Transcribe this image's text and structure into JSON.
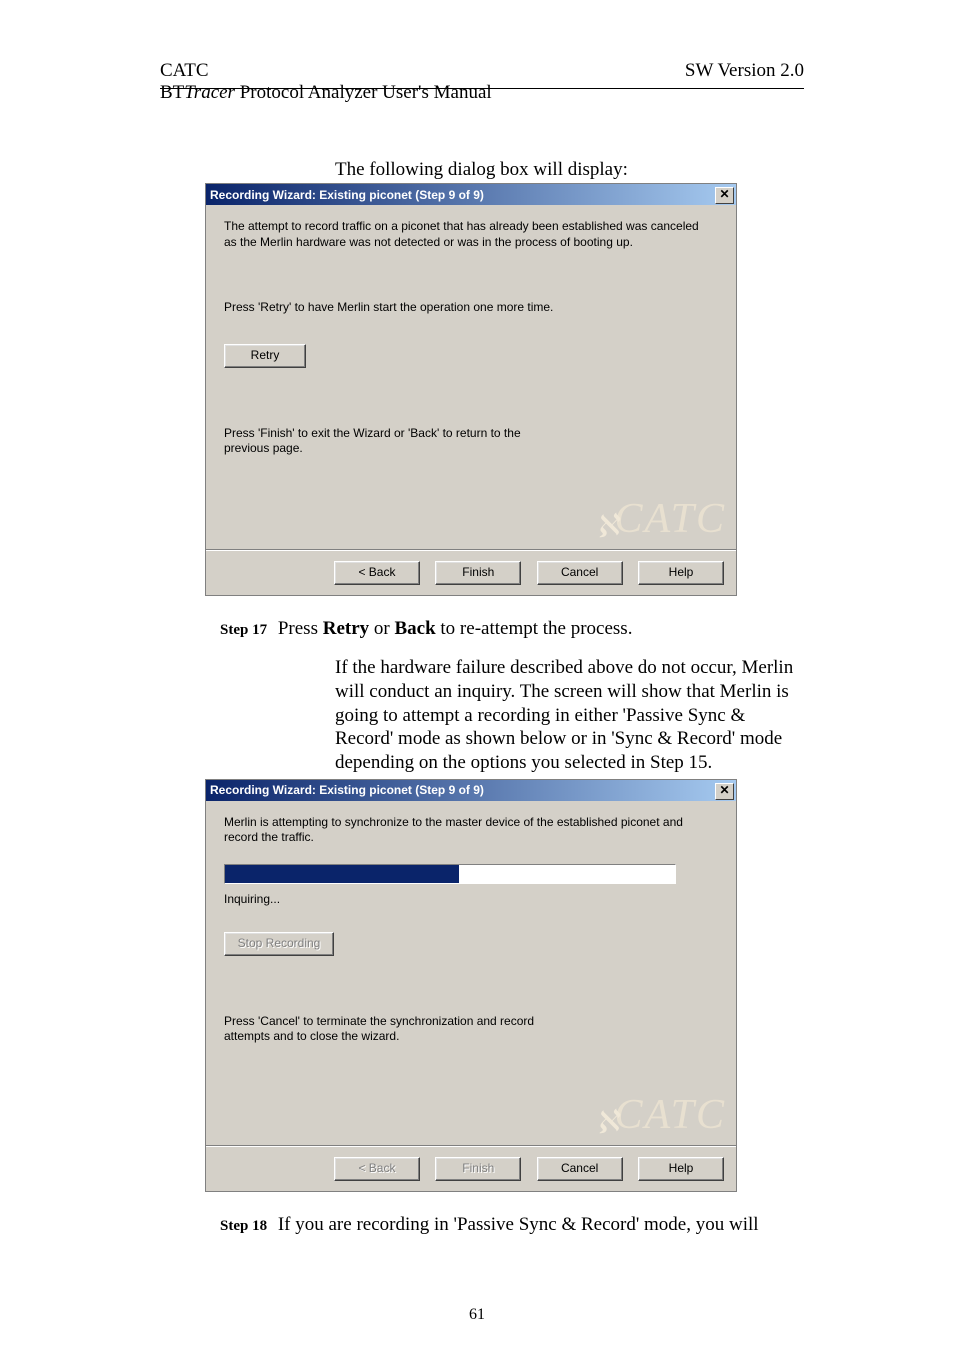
{
  "header": {
    "left": "CATC",
    "center_prefix": "BT",
    "center_italic": "Tracer",
    "center_suffix": " Protocol Analyzer User's Manual",
    "right": "SW Version 2.0"
  },
  "caption1": "The following dialog box will display:",
  "dialog1": {
    "title": "Recording Wizard: Existing piconet (Step 9 of 9)",
    "msg1": "The attempt to record traffic on a piconet that has already been established was canceled as the Merlin hardware was not detected or was in the process of booting up.",
    "msg2": "Press 'Retry' to have Merlin start the operation one more time.",
    "retry": "Retry",
    "msg3": "Press 'Finish' to exit the Wizard or 'Back' to return to the previous page.",
    "watermark": "CATC",
    "back": "< Back",
    "finish": "Finish",
    "cancel": "Cancel",
    "help": "Help"
  },
  "step17": {
    "label": "Step 17",
    "text_prefix": "Press ",
    "retry": "Retry",
    "text_mid": " or ",
    "back": "Back",
    "text_suffix": " to re-attempt the process."
  },
  "para1": "If the hardware failure described above do not occur, Merlin will conduct an inquiry.  The screen will show that Merlin is going to attempt a recording in either 'Passive Sync & Record' mode as shown below or in 'Sync & Record' mode depending on the options you selected in Step 15.",
  "dialog2": {
    "title": "Recording Wizard: Existing piconet (Step 9 of 9)",
    "msg1": "Merlin is attempting to synchronize to the master device of the established piconet and record the traffic.",
    "status": "Inquiring...",
    "stop": "Stop Recording",
    "msg3": "Press 'Cancel' to terminate the synchronization and record attempts and to close the wizard.",
    "watermark": "CATC",
    "back": "< Back",
    "finish": "Finish",
    "cancel": "Cancel",
    "help": "Help"
  },
  "step18": {
    "label": "Step 18",
    "text": "If you are recording in 'Passive Sync & Record' mode, you will"
  },
  "page_number": "61"
}
